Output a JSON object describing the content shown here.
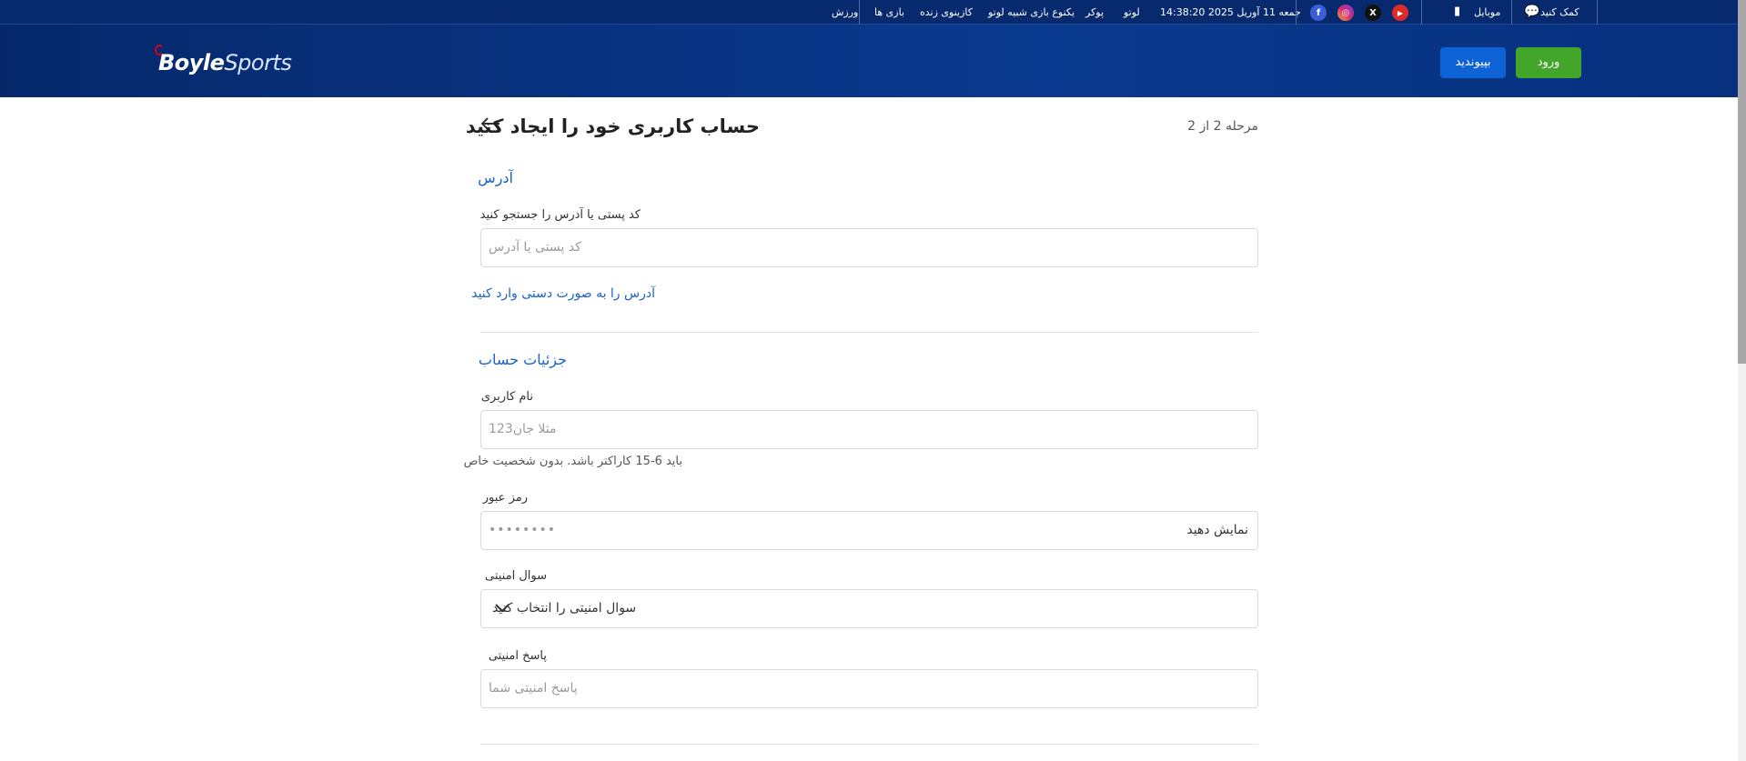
{
  "topbar": {
    "items": [
      "ورزش",
      "بازی ها",
      "کازینوی زنده",
      "یکنوع بازی شبیه لوتو",
      "پوکر",
      "لوتو"
    ],
    "datetime": "جمعه 11 آوریل 2025 14:38:20",
    "mobile_label": "موبایل",
    "help_label": "کمک کنید",
    "social": [
      {
        "name": "facebook",
        "glyph": "f",
        "color": "#3b5ed6"
      },
      {
        "name": "instagram",
        "glyph": "◎",
        "color": "#c13584"
      },
      {
        "name": "x",
        "glyph": "X",
        "color": "#111111"
      },
      {
        "name": "youtube",
        "glyph": "▶",
        "color": "#e02a2a"
      }
    ]
  },
  "header": {
    "logo_boyle": "Boyle",
    "logo_sports": "Sports",
    "join_label": "بپیوندید",
    "login_label": "ورود"
  },
  "form": {
    "title": "حساب کاربری خود را ایجاد کنید",
    "step": "مرحله 2 از 2",
    "address_section": "آدرس",
    "postcode_label": "کد پستی یا آدرس را جستجو کنید",
    "postcode_placeholder": "کد پستی یا آدرس",
    "manual_link": "آدرس را به صورت دستی وارد کنید",
    "account_section": "جزئیات حساب",
    "username_label": "نام کاربری",
    "username_placeholder": "مثلا جان123",
    "username_hint": "باید 6-15 کاراکتر باشد. بدون شخصیت خاص",
    "password_label": "رمز عبور",
    "password_placeholder": "••••••••",
    "show_label": "نمایش دهید",
    "security_q_label": "سوال امنیتی",
    "security_q_value": "سوال امنیتی را انتخاب کنید",
    "security_a_label": "پاسخ امنیتی",
    "security_a_placeholder": "پاسخ امنیتی شما"
  }
}
